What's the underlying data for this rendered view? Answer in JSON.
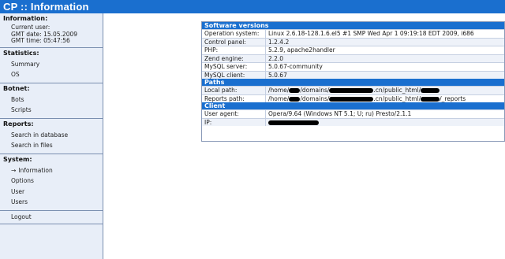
{
  "window": {
    "title": "CP :: Information"
  },
  "sidebar": {
    "information": {
      "title": "Information:",
      "current_user": "Current user:",
      "gmt_date": "GMT date: 15.05.2009",
      "gmt_time": "GMT time: 05:47:56"
    },
    "statistics": {
      "title": "Statistics:",
      "items": [
        "Summary",
        "OS"
      ]
    },
    "botnet": {
      "title": "Botnet:",
      "items": [
        "Bots",
        "Scripts"
      ]
    },
    "reports": {
      "title": "Reports:",
      "items": [
        "Search in database",
        "Search in files"
      ]
    },
    "system": {
      "title": "System:",
      "items": [
        "Information",
        "Options",
        "User",
        "Users"
      ]
    },
    "logout": "Logout"
  },
  "software": {
    "title": "Software versions",
    "rows": [
      {
        "label": "Operation system:",
        "value": "Linux 2.6.18-128.1.6.el5 #1 SMP Wed Apr 1 09:19:18 EDT 2009, i686"
      },
      {
        "label": "Control panel:",
        "value": "1.2.4.2"
      },
      {
        "label": "PHP:",
        "value": "5.2.9, apache2handler"
      },
      {
        "label": "Zend engine:",
        "value": "2.2.0"
      },
      {
        "label": "MySQL server:",
        "value": "5.0.67-community"
      },
      {
        "label": "MySQL client:",
        "value": "5.0.67"
      }
    ]
  },
  "paths": {
    "title": "Paths",
    "local": {
      "label": "Local path:",
      "p1": "/home/",
      "p2": "/domains/",
      "p3": ".cn/public_html/"
    },
    "reports": {
      "label": "Reports path:",
      "p1": "/home/",
      "p2": "/domains/",
      "p3": ".cn/public_html/",
      "p4": "/_reports"
    }
  },
  "client": {
    "title": "Client",
    "user_agent": {
      "label": "User agent:",
      "value": "Opera/9.64 (Windows NT 5.1; U; ru) Presto/2.1.1"
    },
    "ip": {
      "label": "IP:"
    }
  }
}
